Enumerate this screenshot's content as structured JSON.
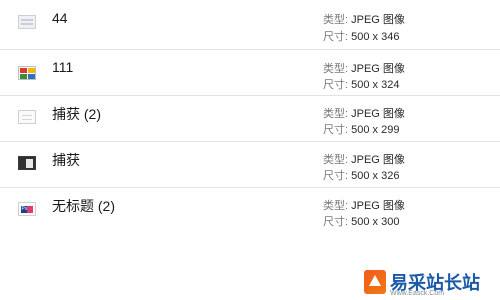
{
  "files": [
    {
      "name": "44",
      "type_label": "类型:",
      "type_value": "JPEG 图像",
      "size_label": "尺寸:",
      "size_value": "500 x 346",
      "thumb_icon": "image-thumbnail-icon"
    },
    {
      "name": "111",
      "type_label": "类型:",
      "type_value": "JPEG 图像",
      "size_label": "尺寸:",
      "size_value": "500 x 324",
      "thumb_icon": "image-thumbnail-icon"
    },
    {
      "name": "捕获 (2)",
      "type_label": "类型:",
      "type_value": "JPEG 图像",
      "size_label": "尺寸:",
      "size_value": "500 x 299",
      "thumb_icon": "image-thumbnail-icon"
    },
    {
      "name": "捕获",
      "type_label": "类型:",
      "type_value": "JPEG 图像",
      "size_label": "尺寸:",
      "size_value": "500 x 326",
      "thumb_icon": "image-thumbnail-icon"
    },
    {
      "name": "无标题 (2)",
      "type_label": "类型:",
      "type_value": "JPEG 图像",
      "size_label": "尺寸:",
      "size_value": "500 x 300",
      "thumb_icon": "image-thumbnail-icon"
    }
  ],
  "watermark": {
    "title": "易采站长站",
    "url": "Www.Easck.Com"
  },
  "colors": {
    "name_text": "#1a1a1a",
    "meta_label": "#7a7a7a",
    "divider": "#e3e3e3",
    "logo_blue": "#1b5aa8",
    "logo_orange": "#f25a1e"
  }
}
